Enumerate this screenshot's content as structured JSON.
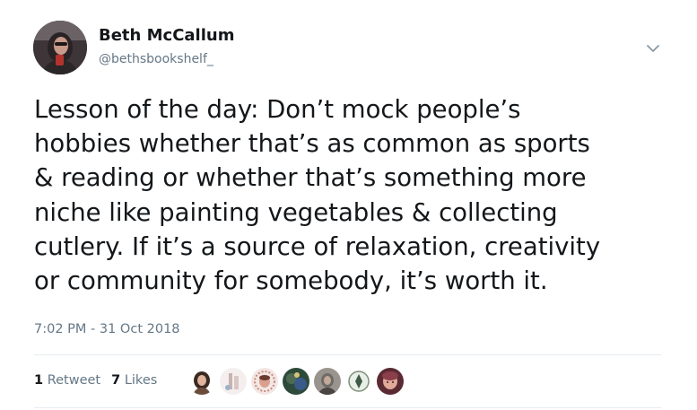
{
  "author": {
    "display_name": "Beth McCallum",
    "handle": "@bethsbookshelf_",
    "avatar_icon": "profile-photo"
  },
  "menu": {
    "icon": "chevron-down-icon"
  },
  "tweet": {
    "text": "Lesson of the day: Don’t mock people’s\nhobbies whether that’s as common as sports\n& reading or whether that’s something more\nniche like painting vegetables & collecting\ncutlery. If it’s a source of relaxation, creativity\nor community for somebody, it’s worth it.",
    "timestamp": "7:02 PM - 31 Oct 2018"
  },
  "stats": {
    "retweets_count": "1",
    "retweets_label": "Retweet",
    "likes_count": "7",
    "likes_label": "Likes"
  },
  "likers": [
    {
      "icon": "liker-avatar-1",
      "color": "#6b4c3b"
    },
    {
      "icon": "liker-avatar-2",
      "color": "#d9c7c4"
    },
    {
      "icon": "liker-avatar-3",
      "color": "#c98a7e"
    },
    {
      "icon": "liker-avatar-4",
      "color": "#4d6b52"
    },
    {
      "icon": "liker-avatar-5",
      "color": "#6e6a66"
    },
    {
      "icon": "liker-avatar-6",
      "color": "#e8efe6"
    },
    {
      "icon": "liker-avatar-7",
      "color": "#8a3f4a"
    }
  ],
  "colors": {
    "text_primary": "#14171a",
    "text_secondary": "#657786",
    "divider": "#e6ecf0"
  }
}
